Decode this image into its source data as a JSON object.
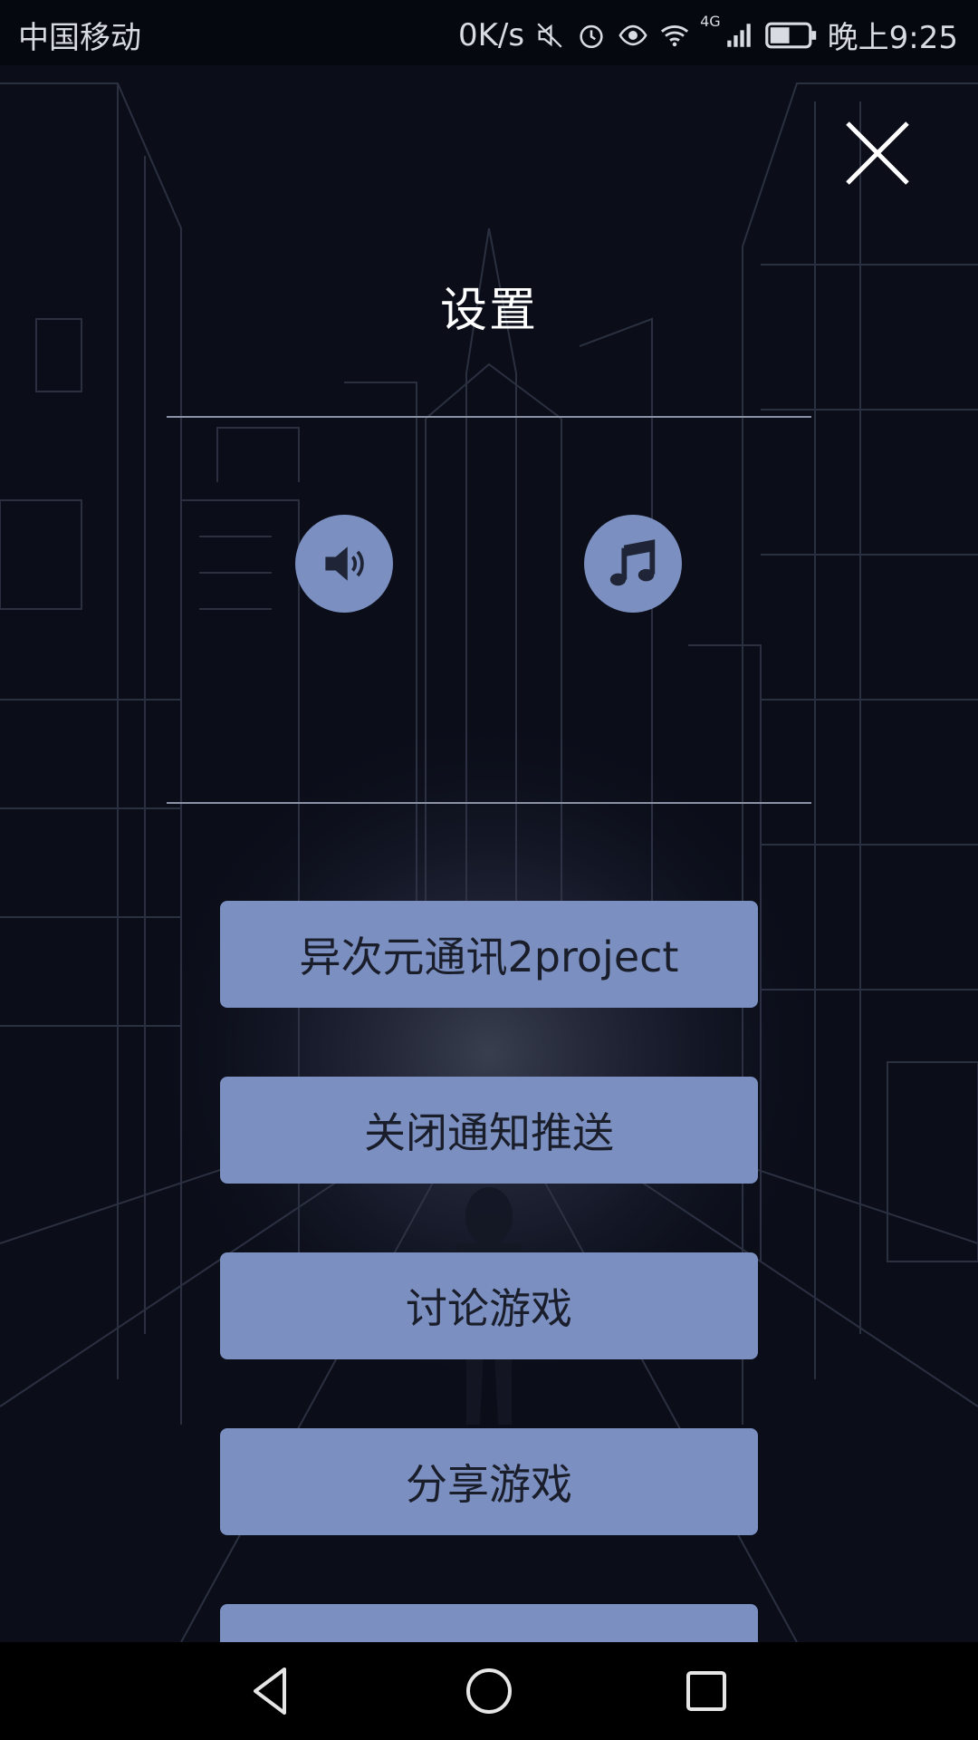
{
  "status_bar": {
    "carrier": "中国移动",
    "net_speed": "0K/s",
    "network_type": "4G",
    "time": "晚上9:25",
    "icons": [
      "mute-icon",
      "alarm-icon",
      "eye-icon",
      "wifi-icon",
      "signal-icon",
      "battery-icon"
    ]
  },
  "dialog": {
    "title": "设置",
    "close_icon": "close-icon",
    "toggles": [
      {
        "icon": "speaker-icon"
      },
      {
        "icon": "music-note-icon"
      }
    ],
    "buttons": [
      {
        "label": "异次元通讯2project"
      },
      {
        "label": "关闭通知推送"
      },
      {
        "label": "讨论游戏"
      },
      {
        "label": "分享游戏"
      }
    ]
  },
  "colors": {
    "accent": "#7b8fc0",
    "background": "#0b0e19",
    "button_text": "#1a1d2a"
  },
  "nav_bar": {
    "icons": [
      "back-icon",
      "home-icon",
      "recents-icon"
    ]
  }
}
